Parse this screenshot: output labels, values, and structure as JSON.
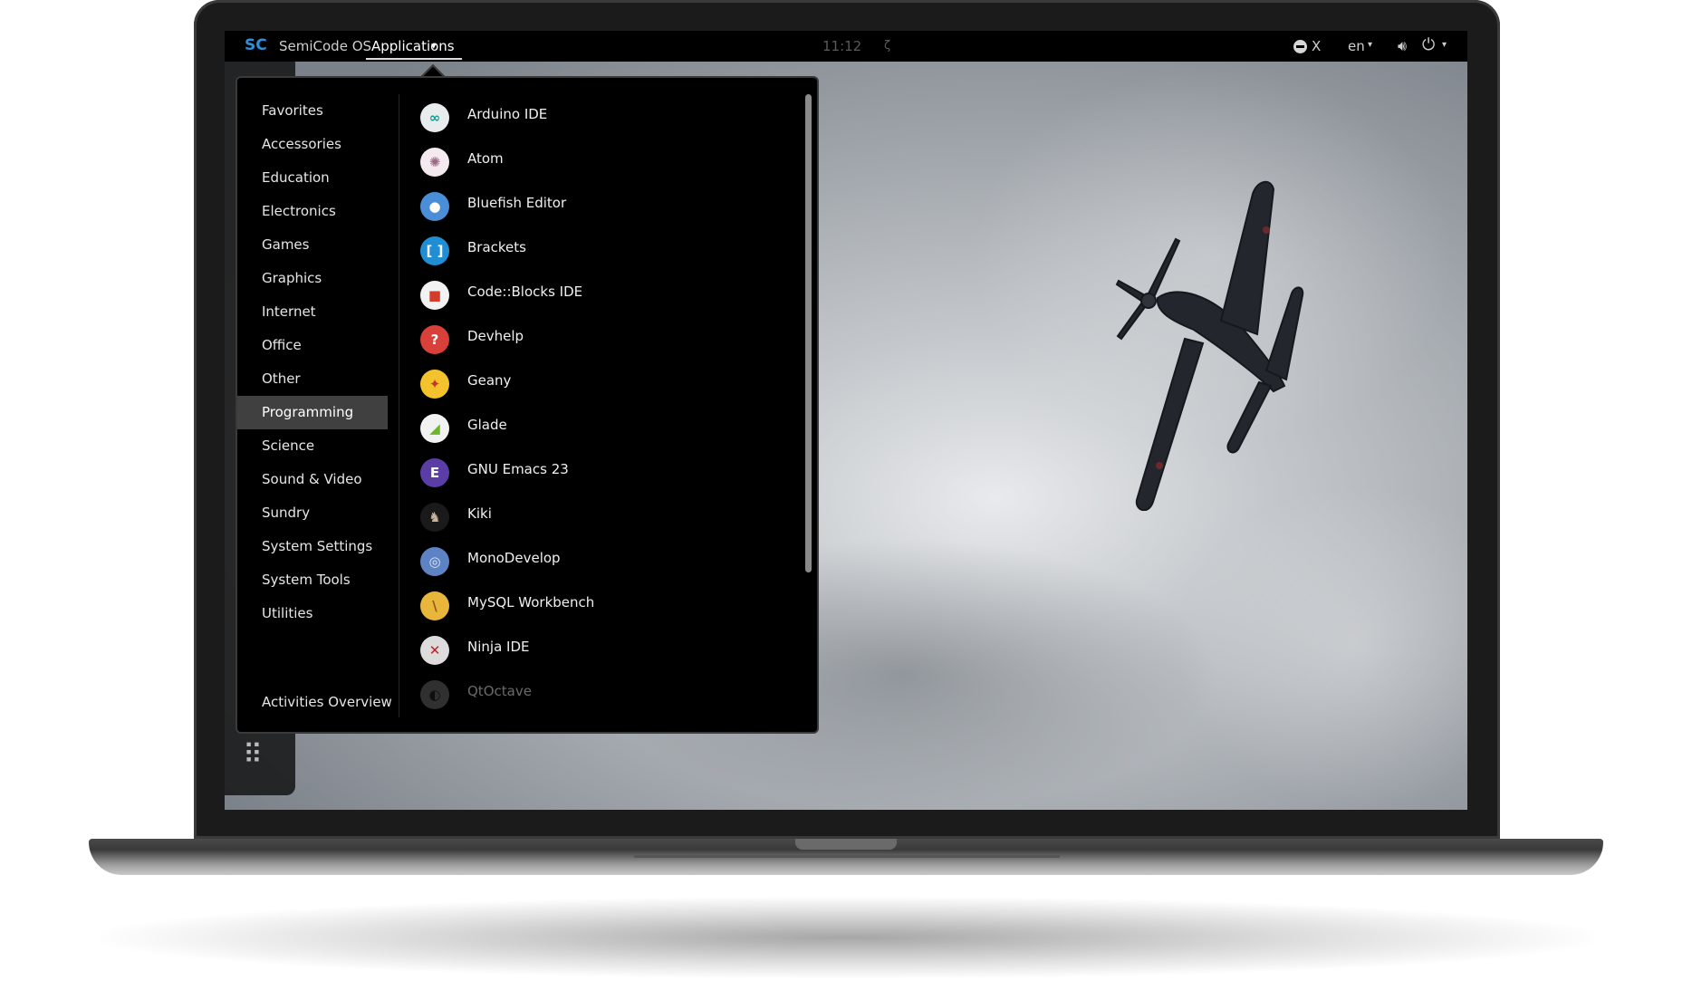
{
  "topbar": {
    "logo_text": "SC",
    "os_name": "SemiCode OS",
    "applications_label": "Applications",
    "clock": "11:12",
    "tray_x": "X",
    "language": "en"
  },
  "menu": {
    "categories": [
      {
        "label": "Favorites"
      },
      {
        "label": "Accessories"
      },
      {
        "label": "Education"
      },
      {
        "label": "Electronics"
      },
      {
        "label": "Games"
      },
      {
        "label": "Graphics"
      },
      {
        "label": "Internet"
      },
      {
        "label": "Office"
      },
      {
        "label": "Other"
      },
      {
        "label": "Programming",
        "active": true
      },
      {
        "label": "Science"
      },
      {
        "label": "Sound & Video"
      },
      {
        "label": "Sundry"
      },
      {
        "label": "System Settings"
      },
      {
        "label": "System Tools"
      },
      {
        "label": "Utilities"
      }
    ],
    "activities_label": "Activities Overview",
    "apps": [
      {
        "label": "Arduino IDE",
        "icon": "arduino-icon",
        "color": "#e9ecec",
        "glyph": "∞",
        "glyph_color": "#11988f"
      },
      {
        "label": "Atom",
        "icon": "atom-icon",
        "color": "#f3e9ef",
        "glyph": "✺",
        "glyph_color": "#9a6b86"
      },
      {
        "label": "Bluefish Editor",
        "icon": "bluefish-icon",
        "color": "#4a8ed8",
        "glyph": "●",
        "glyph_color": "#ffffff"
      },
      {
        "label": "Brackets",
        "icon": "brackets-icon",
        "color": "#1f8ed3",
        "glyph": "[ ]",
        "glyph_color": "#ffffff"
      },
      {
        "label": "Code::Blocks IDE",
        "icon": "codeblocks-icon",
        "color": "#f2f2f2",
        "glyph": "■",
        "glyph_color": "#d33b2c"
      },
      {
        "label": "Devhelp",
        "icon": "devhelp-icon",
        "color": "#d9403a",
        "glyph": "?",
        "glyph_color": "#ffffff"
      },
      {
        "label": "Geany",
        "icon": "geany-icon",
        "color": "#f3c22c",
        "glyph": "✦",
        "glyph_color": "#c0392b"
      },
      {
        "label": "Glade",
        "icon": "glade-icon",
        "color": "#f2f2f2",
        "glyph": "◢",
        "glyph_color": "#6cb52c"
      },
      {
        "label": "GNU Emacs 23",
        "icon": "emacs-icon",
        "color": "#5a3ea6",
        "glyph": "E",
        "glyph_color": "#ffffff"
      },
      {
        "label": "Kiki",
        "icon": "kiki-icon",
        "color": "#1a1a1a",
        "glyph": "♞",
        "glyph_color": "#c9b49a"
      },
      {
        "label": "MonoDevelop",
        "icon": "monodevelop-icon",
        "color": "#5d83c4",
        "glyph": "◎",
        "glyph_color": "#dbe6f5"
      },
      {
        "label": "MySQL Workbench",
        "icon": "mysql-workbench-icon",
        "color": "#e8b63a",
        "glyph": "\\",
        "glyph_color": "#8a5a12"
      },
      {
        "label": "Ninja IDE",
        "icon": "ninja-ide-icon",
        "color": "#dcdcdc",
        "glyph": "✕",
        "glyph_color": "#b3262a"
      },
      {
        "label": "QtOctave",
        "icon": "qtoctave-icon",
        "color": "#6a6a6a",
        "glyph": "◐",
        "glyph_color": "#222222",
        "faded": true
      }
    ]
  },
  "colors": {
    "accent": "#2f8fd8",
    "active_category_bg": "#404040",
    "menu_bg": "#000000"
  }
}
